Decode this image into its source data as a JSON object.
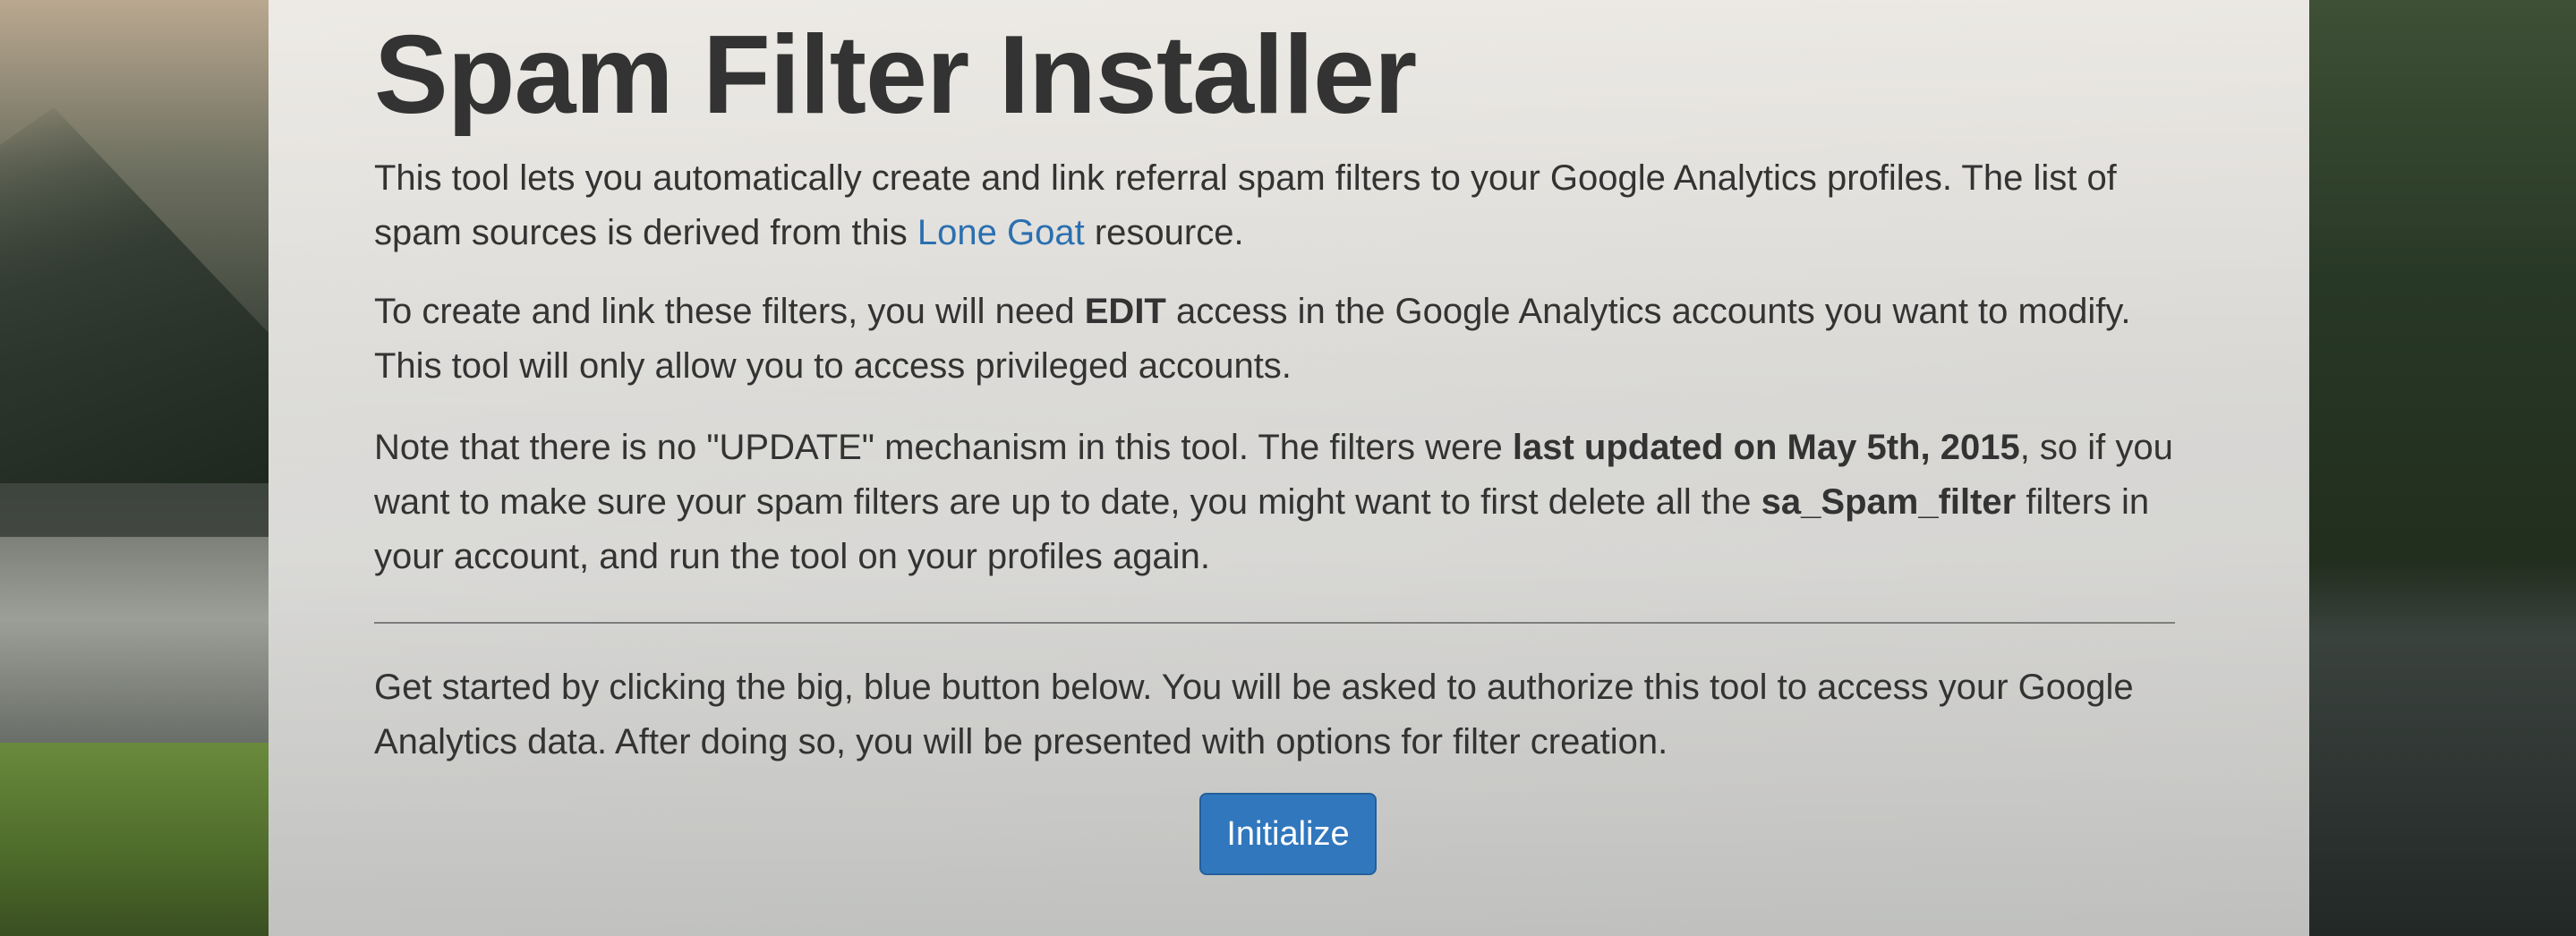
{
  "page": {
    "title": "Spam Filter Installer"
  },
  "intro": {
    "p1_before": "This tool lets you automatically create and link referral spam filters to your Google Analytics profiles. The list of spam sources is derived from this ",
    "p1_link": "Lone Goat",
    "p1_after": " resource.",
    "p2_before": "To create and link these filters, you will need ",
    "p2_bold": "EDIT",
    "p2_after": " access in the Google Analytics accounts you want to modify. This tool will only allow you to access privileged accounts.",
    "p3_before": "Note that there is no \"UPDATE\" mechanism in this tool. The filters were ",
    "p3_bold1": "last updated on May 5th, 2015",
    "p3_middle": ", so if you want to make sure your spam filters are up to date, you might want to first delete all the ",
    "p3_bold2": "sa_Spam_filter",
    "p3_after": " filters in your account, and run the tool on your profiles again."
  },
  "getting_started": {
    "text": "Get started by clicking the big, blue button below. You will be asked to authorize this tool to access your Google Analytics data. After doing so, you will be presented with options for filter creation.",
    "button_label": "Initialize"
  },
  "colors": {
    "link": "#2a6fb0",
    "button": "#3177bd",
    "text": "#333333"
  }
}
